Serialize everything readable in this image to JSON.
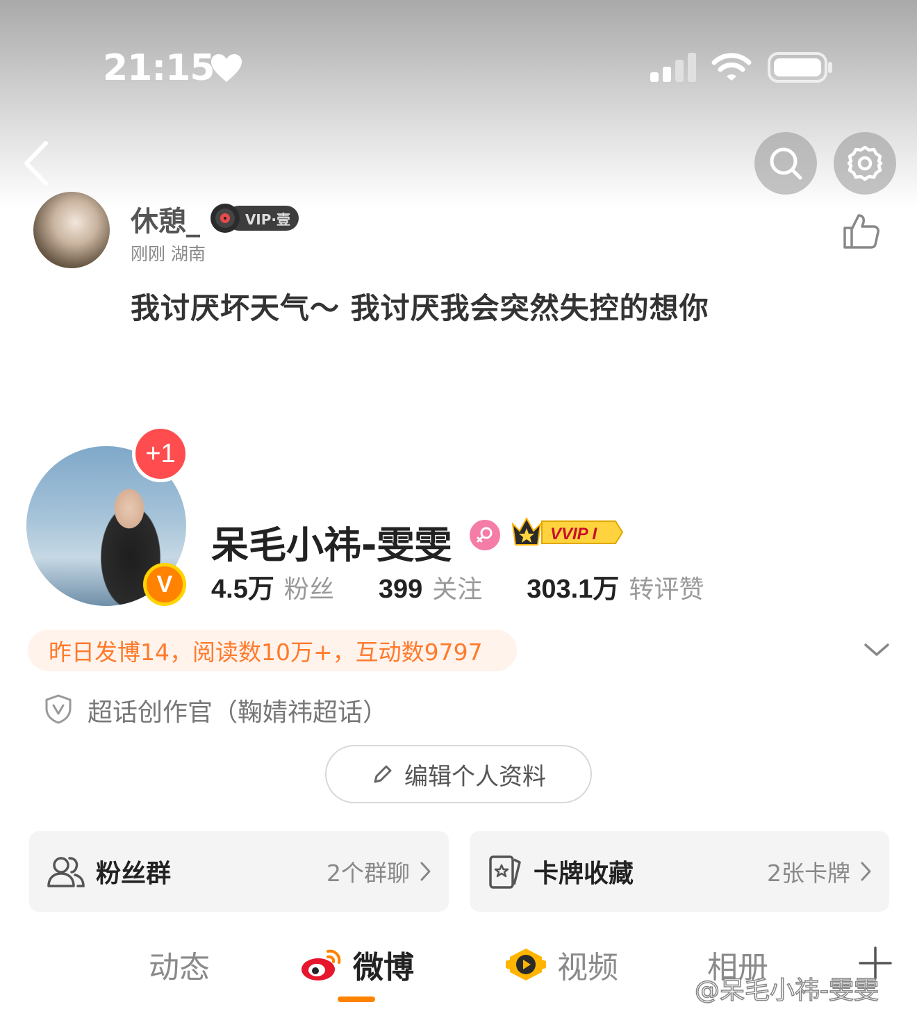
{
  "status_bar": {
    "time": "21:15"
  },
  "post": {
    "username": "休憩_",
    "vip_label": "VIP·壹",
    "meta": "刚刚 湖南",
    "text": "我讨厌坏天气～ 我讨厌我会突然失控的想你"
  },
  "profile": {
    "avatar_badge": "+1",
    "verified_badge": "V",
    "name": "呆毛小祎-雯雯",
    "vvip_label": "VVIP I",
    "stats": [
      {
        "value": "4.5万",
        "label": "粉丝"
      },
      {
        "value": "399",
        "label": "关注"
      },
      {
        "value": "303.1万",
        "label": "转评赞"
      }
    ],
    "activity": "昨日发博14，阅读数10万+，互动数9797",
    "super_topic": "超话创作官（鞠婧祎超话）",
    "edit_button": "编辑个人资料"
  },
  "cards": {
    "fans_group": {
      "title": "粉丝群",
      "count": "2个群聊"
    },
    "card_collection": {
      "title": "卡牌收藏",
      "count": "2张卡牌"
    }
  },
  "tabs": [
    {
      "label": "动态"
    },
    {
      "label": "微博"
    },
    {
      "label": "视频"
    },
    {
      "label": "相册"
    }
  ],
  "watermark": "@呆毛小祎-雯雯",
  "colors": {
    "accent": "#ff8200",
    "activity_text": "#ff7a2b",
    "badge_red": "#ff4d4f"
  }
}
